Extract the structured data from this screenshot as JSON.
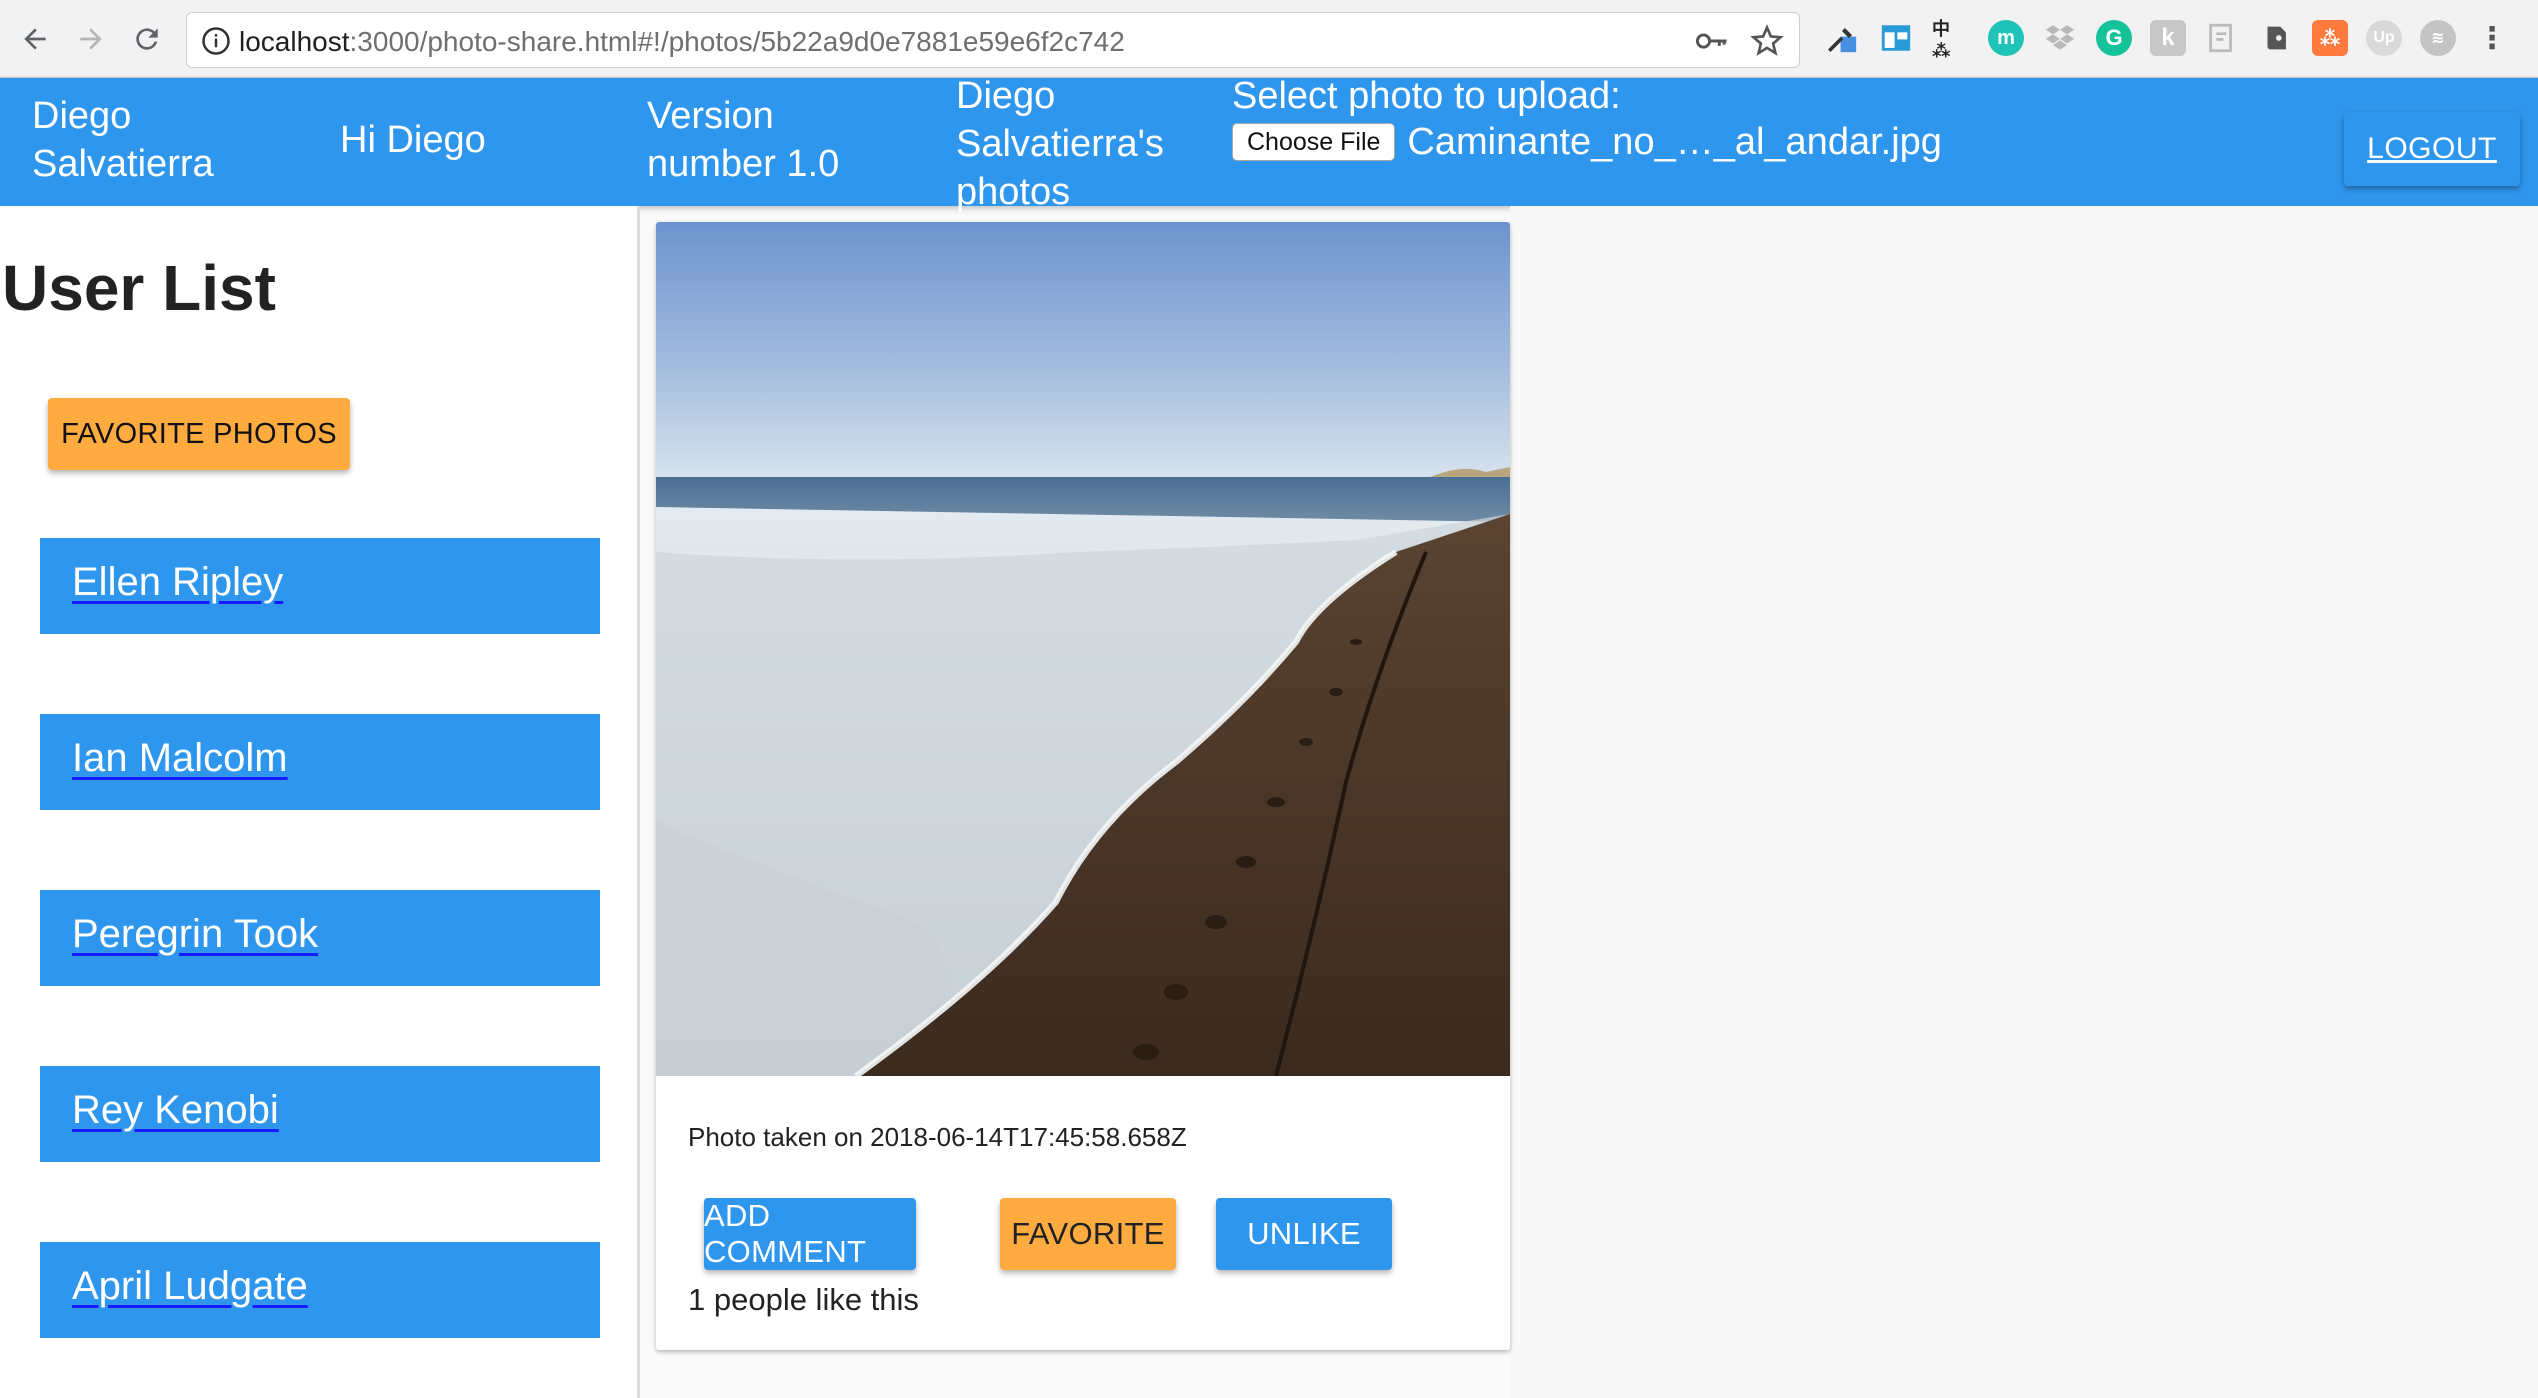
{
  "browser": {
    "url_host": "localhost",
    "url_rest": ":3000/photo-share.html#!/photos/5b22a9d0e7881e59e6f2c742",
    "icons": [
      "back-icon",
      "forward-icon",
      "reload-icon",
      "info-icon",
      "key-icon",
      "star-icon"
    ],
    "extensions": [
      "eyedropper-extension-icon",
      "window-extension-icon",
      "translate-extension-icon",
      "m-extension-icon",
      "dropbox-extension-icon",
      "grammarly-extension-icon",
      "k-extension-icon",
      "note-extension-icon",
      "evernote-extension-icon",
      "hubspot-extension-icon",
      "upwork-extension-icon",
      "spotify-extension-icon",
      "menu-icon"
    ]
  },
  "header": {
    "username": "Diego Salvatierra",
    "greeting": "Hi Diego",
    "version": "Version number 1.0",
    "context": "Diego Salvatierra's photos",
    "upload_label": "Select photo to upload:",
    "choose_file_label": "Choose File",
    "file_name": "Caminante_no_…_al_andar.jpg",
    "logout_label": "LOGOUT"
  },
  "sidebar": {
    "title": "User List",
    "favorite_photos_label": "FAVORITE PHOTOS",
    "users": [
      "Ellen Ripley",
      "Ian Malcolm",
      "Peregrin Took",
      "Rey Kenobi",
      "April Ludgate"
    ]
  },
  "photo": {
    "date_text": "Photo taken on 2018-06-14T17:45:58.658Z",
    "add_comment_label": "ADD COMMENT",
    "favorite_label": "FAVORITE",
    "unlike_label": "UNLIKE",
    "likes_text": "1 people like this"
  },
  "colors": {
    "primary": "#2f96ee",
    "accent": "#ffab40"
  }
}
